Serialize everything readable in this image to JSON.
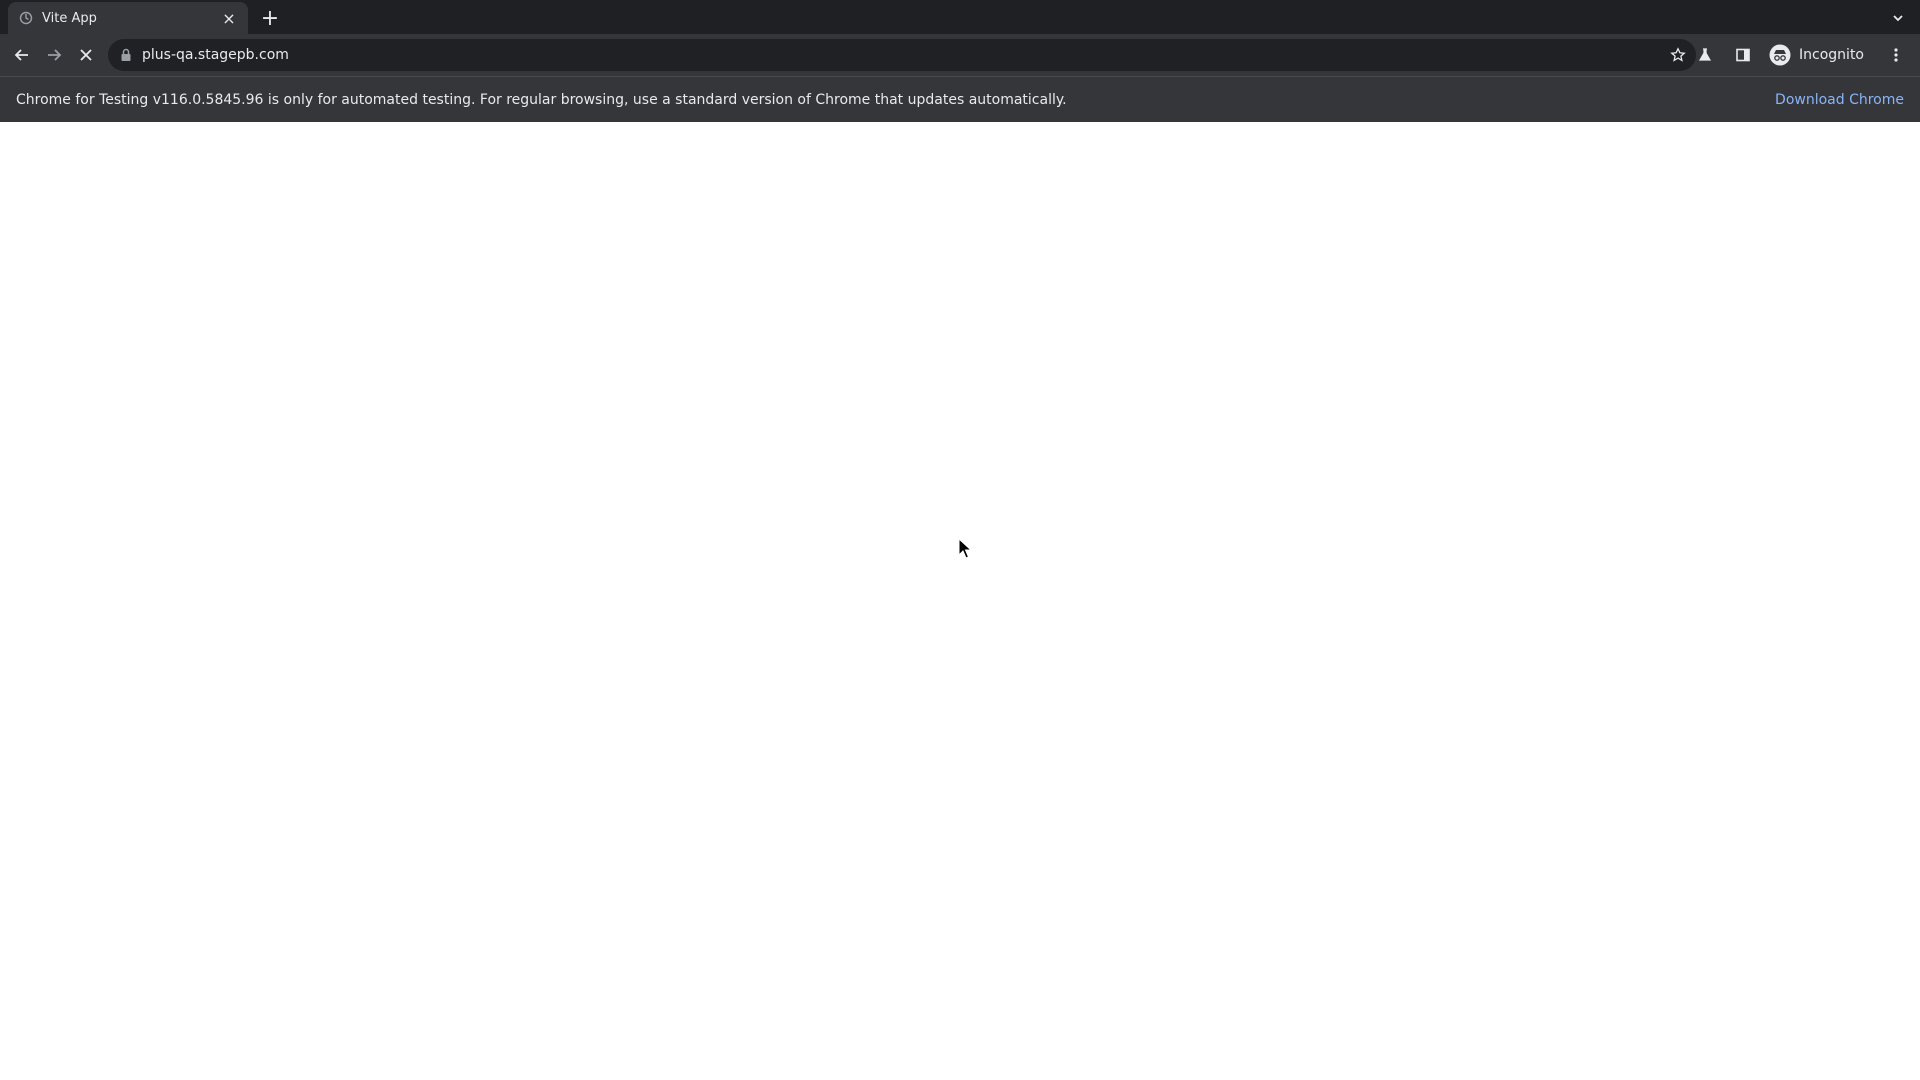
{
  "browser": {
    "tab": {
      "title": "Vite App",
      "favicon": "vite-favicon-icon"
    },
    "new_tab_symbol": "+",
    "close_symbol": "×",
    "address": {
      "url": "plus-qa.stagepb.com"
    },
    "profile": {
      "label": "Incognito"
    },
    "infobar": {
      "message": "Chrome for Testing v116.0.5845.96 is only for automated testing. For regular browsing, use a standard version of Chrome that updates automatically.",
      "link": "Download Chrome"
    }
  },
  "colors": {
    "tabstrip": "#1f2023",
    "toolbar": "#35363a",
    "omnibox": "#202124",
    "text": "#e8eaed",
    "link": "#8ab4f8",
    "page": "#ffffff"
  }
}
